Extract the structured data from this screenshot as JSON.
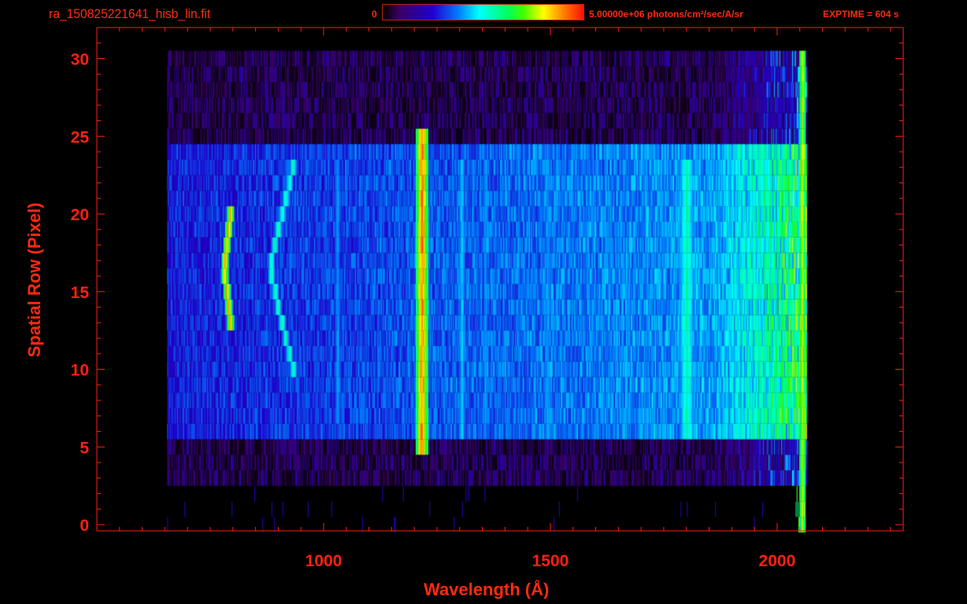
{
  "header": {
    "filename": "ra_150825221641_hisb_lin.fit",
    "colorbar_min": "0",
    "colorbar_max": "5.00000e+06 photons/cm²/sec/A/sr",
    "exptime": "EXPTIME = 604 s"
  },
  "colors": {
    "axis": "#ff2010",
    "background": "#000000"
  },
  "chart_data": {
    "type": "heatmap",
    "title": "ra_150825221641_hisb_lin.fit",
    "xlabel": "Wavelength (Å)",
    "ylabel": "Spatial Row (Pixel)",
    "xlim": [
      500,
      2278
    ],
    "ylim": [
      -0.4,
      32
    ],
    "xticks": [
      "1000",
      "1500",
      "2000"
    ],
    "xtick_values": [
      1000,
      1500,
      2000
    ],
    "yticks": [
      "0",
      "5",
      "10",
      "15",
      "20",
      "25",
      "30"
    ],
    "ytick_values": [
      0,
      5,
      10,
      15,
      20,
      25,
      30
    ],
    "colormap": "rainbow",
    "zlim": [
      0,
      5000000
    ],
    "zunit": "photons/cm^2/sec/A/sr",
    "data_extent": {
      "wavelength": [
        655,
        2065
      ],
      "rows": [
        0,
        30
      ]
    },
    "signal_rows": [
      6,
      24
    ],
    "features": [
      {
        "name": "arc feature",
        "wavelength": 780,
        "rows": [
          13,
          20
        ],
        "intensity": 0.95
      },
      {
        "name": "arc feature",
        "wavelength": 880,
        "rows": [
          10,
          23
        ],
        "intensity": 0.6
      },
      {
        "name": "line",
        "wavelength": 1030,
        "rows": [
          7,
          23
        ],
        "intensity": 0.45
      },
      {
        "name": "Lyman alpha",
        "wavelength": 1216,
        "rows": [
          5,
          25
        ],
        "intensity": 1.0
      },
      {
        "name": "line",
        "wavelength": 1304,
        "rows": [
          6,
          23
        ],
        "intensity": 0.5
      },
      {
        "name": "line",
        "wavelength": 1356,
        "rows": [
          6,
          23
        ],
        "intensity": 0.45
      },
      {
        "name": "line",
        "wavelength": 1430,
        "rows": [
          6,
          23
        ],
        "intensity": 0.4
      },
      {
        "name": "line",
        "wavelength": 1493,
        "rows": [
          6,
          23
        ],
        "intensity": 0.45
      },
      {
        "name": "band",
        "wavelength": 1800,
        "rows": [
          6,
          23
        ],
        "intensity": 0.6
      },
      {
        "name": "edge",
        "wavelength": 2055,
        "rows": [
          0,
          30
        ],
        "intensity": 0.85
      }
    ]
  }
}
